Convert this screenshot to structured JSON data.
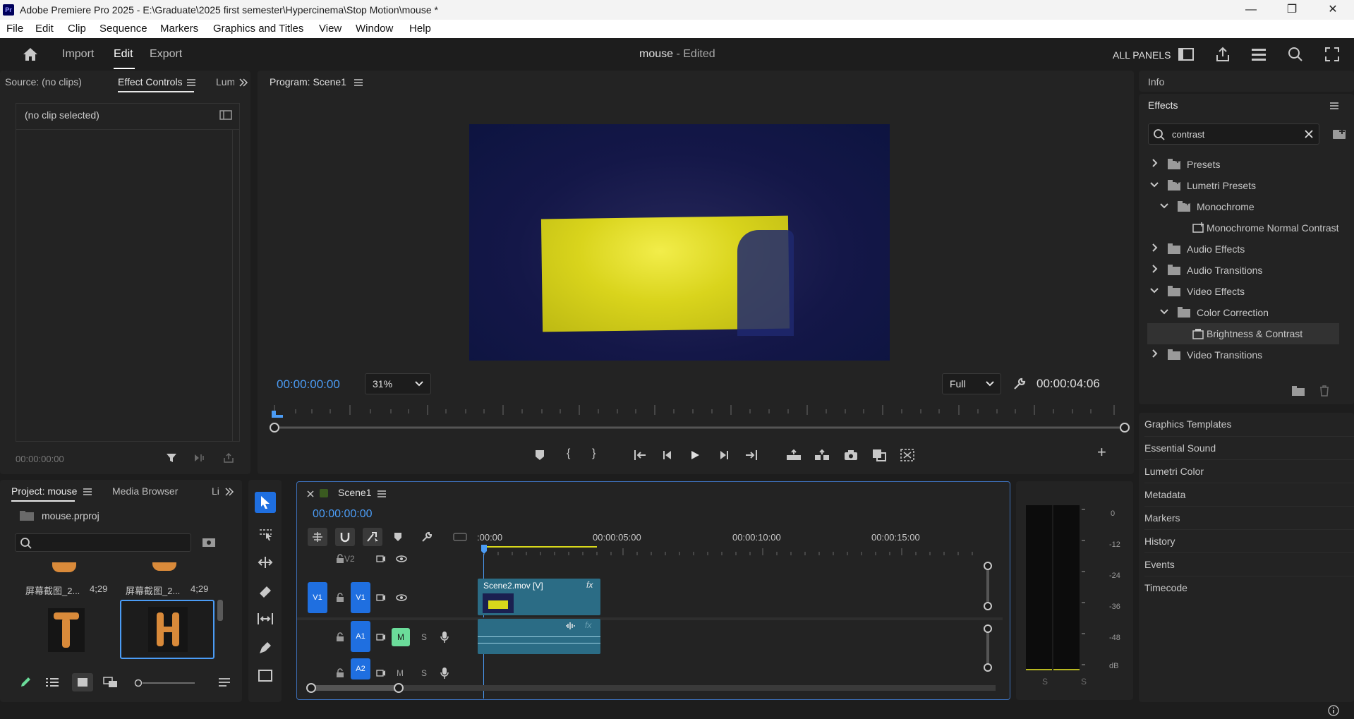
{
  "window": {
    "app_icon": "Pr",
    "title": "Adobe Premiere Pro 2025 - E:\\Graduate\\2025 first semester\\Hypercinema\\Stop Motion\\mouse *",
    "controls": [
      "minimize-icon",
      "restore-icon",
      "close-icon"
    ]
  },
  "menu": [
    "File",
    "Edit",
    "Clip",
    "Sequence",
    "Markers",
    "Graphics and Titles",
    "View",
    "Window",
    "Help"
  ],
  "header": {
    "tabs": [
      "Import",
      "Edit",
      "Export"
    ],
    "active_tab": "Edit",
    "project_name": "mouse",
    "project_status": "- Edited",
    "all_panels": "ALL PANELS"
  },
  "source_panel": {
    "tabs": [
      "Source: (no clips)",
      "Effect Controls",
      "Lum"
    ],
    "no_clip": "(no clip selected)",
    "timecode": "00:00:00:00"
  },
  "program_monitor": {
    "title": "Program: Scene1",
    "timecode": "00:00:00:00",
    "zoom": "31%",
    "quality": "Full",
    "duration": "00:00:04:06"
  },
  "right_panel": {
    "info_label": "Info",
    "effects_label": "Effects",
    "search_value": "contrast",
    "tree": [
      {
        "label": "Presets",
        "depth": 0,
        "expanded": false,
        "type": "preset-folder"
      },
      {
        "label": "Lumetri Presets",
        "depth": 0,
        "expanded": true,
        "type": "preset-folder"
      },
      {
        "label": "Monochrome",
        "depth": 1,
        "expanded": true,
        "type": "preset-folder"
      },
      {
        "label": "Monochrome Normal Contrast",
        "depth": 2,
        "expanded": null,
        "type": "preset"
      },
      {
        "label": "Audio Effects",
        "depth": 0,
        "expanded": false,
        "type": "folder"
      },
      {
        "label": "Audio Transitions",
        "depth": 0,
        "expanded": false,
        "type": "folder"
      },
      {
        "label": "Video Effects",
        "depth": 0,
        "expanded": true,
        "type": "folder"
      },
      {
        "label": "Color Correction",
        "depth": 1,
        "expanded": true,
        "type": "folder"
      },
      {
        "label": "Brightness & Contrast",
        "depth": 2,
        "expanded": null,
        "type": "effect",
        "selected": true
      },
      {
        "label": "Video Transitions",
        "depth": 0,
        "expanded": false,
        "type": "folder"
      }
    ],
    "side_panels": [
      "Graphics Templates",
      "Essential Sound",
      "Lumetri Color",
      "Metadata",
      "Markers",
      "History",
      "Events",
      "Timecode"
    ]
  },
  "project_panel": {
    "tabs": [
      "Project: mouse",
      "Media Browser",
      "Li"
    ],
    "file": "mouse.prproj",
    "items": [
      {
        "name": "屏幕截图_2...",
        "duration": "4;29"
      },
      {
        "name": "屏幕截图_2...",
        "duration": "4;29"
      }
    ]
  },
  "timeline": {
    "sequence_name": "Scene1",
    "timecode": "00:00:00:00",
    "ruler": [
      ":00:00",
      "00:00:05:00",
      "00:00:10:00",
      "00:00:15:00"
    ],
    "tracks": {
      "v2": "V2",
      "v1": "V1",
      "a1": "A1",
      "a2": "A2",
      "mute": "M",
      "solo": "S"
    },
    "clip_name": "Scene2.mov [V]",
    "fx": "fx"
  },
  "audio_meter": {
    "scale": [
      "0",
      "-12",
      "-24",
      "-36",
      "-48",
      "dB"
    ],
    "solo_labels": [
      "S",
      "S"
    ]
  },
  "colors": {
    "accent_blue": "#4b9cf5",
    "track_blue": "#1f6fe0",
    "clip_teal": "#2b6c85",
    "mute_green": "#6bdc9a",
    "frame_yellow": "#d8d81b"
  }
}
